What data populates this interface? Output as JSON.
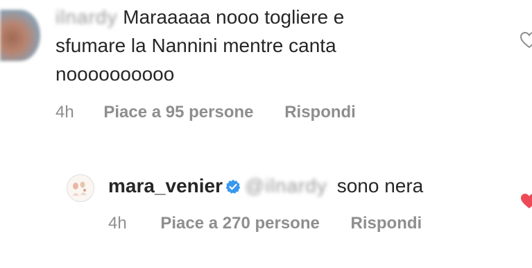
{
  "comments": [
    {
      "username": "ilnardy",
      "text_line1": "Maraaaaa nooo togliere e",
      "text_line2": "sfumare la Nannini mentre canta",
      "text_line3": "noooooooooo",
      "time": "4h",
      "likes": "Piace a 95 persone",
      "reply": "Rispondi"
    },
    {
      "username": "mara_venier",
      "verified": true,
      "mention": "@ilnardy",
      "text": "sono nera",
      "time": "4h",
      "likes": "Piace a 270 persone",
      "reply": "Rispondi"
    }
  ],
  "icons": {
    "heart_outline": "heart-outline-icon",
    "heart_filled": "heart-filled-icon",
    "verified": "verified-badge-icon"
  },
  "colors": {
    "text": "#262626",
    "meta": "#8e8e8e",
    "verified_blue": "#3897f0",
    "heart_red": "#ed4956"
  }
}
